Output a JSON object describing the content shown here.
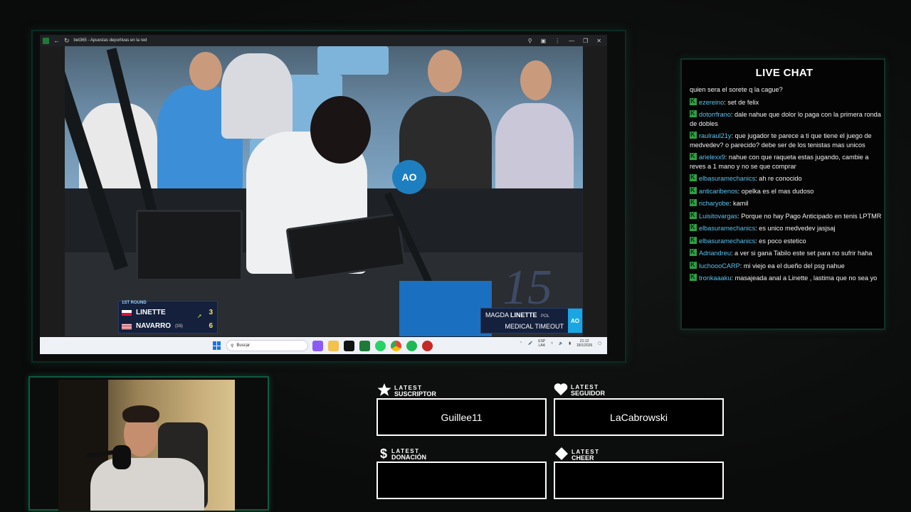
{
  "browser": {
    "title": "bet365 - Apuestas deportivas en la red"
  },
  "scoreboard": {
    "round": "1ST ROUND",
    "players": [
      {
        "name": "LINETTE",
        "seed": "",
        "score": "3",
        "flag": "POL"
      },
      {
        "name": "NAVARRO",
        "seed": "(15)",
        "score": "6",
        "flag": "USA"
      }
    ]
  },
  "caption": {
    "first_name": "MAGDA",
    "last_name": "LINETTE",
    "country": "POL",
    "status": "MEDICAL TIMEOUT",
    "logo": "AO"
  },
  "video": {
    "mic_logo": "AO",
    "court_number": "15"
  },
  "taskbar": {
    "search_placeholder": "Buscar",
    "language": "ESP",
    "keyboard": "LAA",
    "time": "21:12",
    "date": "18/1/2026"
  },
  "chat": {
    "title": "LIVE CHAT",
    "messages": [
      {
        "user": "",
        "text": "quien sera el sorete q la cague?"
      },
      {
        "user": "ezereino",
        "text": ": set de felix"
      },
      {
        "user": "dotorrfrano",
        "text": ": dale nahue que dolor lo paga con la primera ronda de dobles"
      },
      {
        "user": "raulraul21y",
        "text": ": que jugador te parece a ti que tiene el juego de medvedev? o parecido? debe ser de los tenistas mas unicos"
      },
      {
        "user": "arielexx9",
        "text": ": nahue con que raqueta estas jugando, cambie a reves a 1 mano y no se que comprar"
      },
      {
        "user": "elbasuramechanics",
        "text": ": ah re conocido"
      },
      {
        "user": "anticaribenos",
        "text": ": opelka es el mas dudoso"
      },
      {
        "user": "richaryobe",
        "text": ": kamil"
      },
      {
        "user": "Luisitovargas",
        "text": ": Porque no hay Pago Anticipado en tenis LPTMR"
      },
      {
        "user": "elbasuramechanics",
        "text": ": es unico medvedev jasjsaj"
      },
      {
        "user": "elbasuramechanics",
        "text": ": es poco estetico"
      },
      {
        "user": "Adriandreu",
        "text": ": a ver si gana Tabilo este set para no sufrir haha"
      },
      {
        "user": "luchoooCARP",
        "text": ": mi viejo ea el dueño del psg nahue"
      },
      {
        "user": "tronkaaaku",
        "text": ": masajeada anal a Linette , lastima que no sea yo"
      }
    ]
  },
  "alerts": {
    "subscriber": {
      "latest": "LATEST",
      "label": "SUSCRIPTOR",
      "value": "Guillee11"
    },
    "follower": {
      "latest": "LATEST",
      "label": "SEGUIDOR",
      "value": "LaCabrowski"
    },
    "donation": {
      "latest": "LATEST",
      "label": "DONACIÓN",
      "value": ""
    },
    "cheer": {
      "latest": "LATEST",
      "label": "CHEER",
      "value": ""
    }
  },
  "colors": {
    "accent_green": "#0f5a40",
    "chat_username": "#58c3f0",
    "scoreboard_navy": "#14203c",
    "ao_blue": "#19a6e3"
  }
}
